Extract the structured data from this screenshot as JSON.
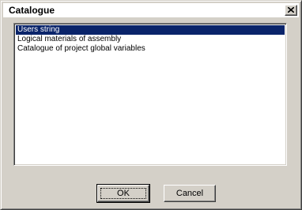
{
  "window": {
    "title": "Catalogue"
  },
  "list": {
    "items": [
      {
        "label": "Users string",
        "selected": true
      },
      {
        "label": "Logical materials of assembly",
        "selected": false
      },
      {
        "label": "Catalogue of project global variables",
        "selected": false
      }
    ]
  },
  "buttons": {
    "ok_label": "OK",
    "cancel_label": "Cancel"
  },
  "colors": {
    "selection": "#0a246a",
    "face": "#d4d0c8"
  },
  "icons": {
    "close": "close-icon"
  }
}
